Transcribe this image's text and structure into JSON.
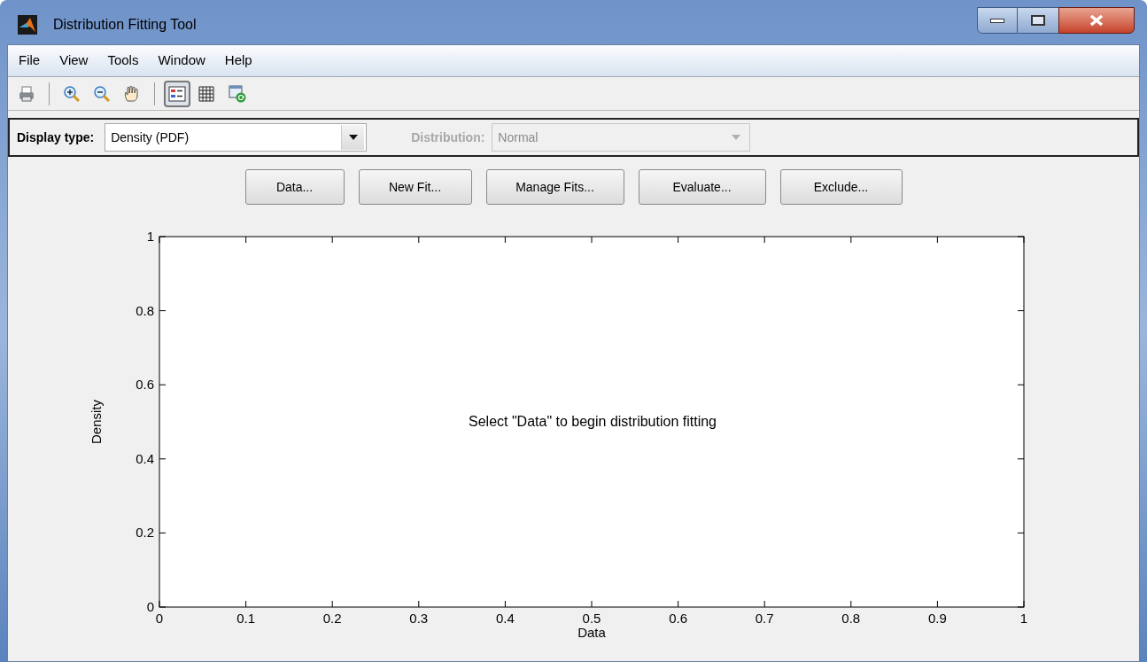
{
  "window": {
    "title": "Distribution Fitting Tool"
  },
  "menu": [
    "File",
    "View",
    "Tools",
    "Window",
    "Help"
  ],
  "toolbar": [
    {
      "pressed": false
    },
    {
      "pressed": false
    },
    {
      "pressed": false
    },
    {
      "pressed": false
    },
    {
      "pressed": true
    },
    {
      "pressed": false
    },
    {
      "pressed": false
    }
  ],
  "display_type": {
    "label": "Display type:",
    "value": "Density (PDF)",
    "disabled": false
  },
  "distribution": {
    "label": "Distribution:",
    "value": "Normal",
    "disabled": true
  },
  "buttons": [
    "Data...",
    "New Fit...",
    "Manage Fits...",
    "Evaluate...",
    "Exclude..."
  ],
  "plot": {
    "message": "Select \"Data\" to begin distribution fitting",
    "chart_data": {
      "type": "line",
      "xlabel": "Data",
      "ylabel": "Density",
      "xlim": [
        0,
        1
      ],
      "ylim": [
        0,
        1
      ],
      "xticks": [
        {
          "value": 0,
          "label": "0"
        },
        {
          "value": 0.1,
          "label": "0.1"
        },
        {
          "value": 0.2,
          "label": "0.2"
        },
        {
          "value": 0.3,
          "label": "0.3"
        },
        {
          "value": 0.4,
          "label": "0.4"
        },
        {
          "value": 0.5,
          "label": "0.5"
        },
        {
          "value": 0.6,
          "label": "0.6"
        },
        {
          "value": 0.7,
          "label": "0.7"
        },
        {
          "value": 0.8,
          "label": "0.8"
        },
        {
          "value": 0.9,
          "label": "0.9"
        },
        {
          "value": 1,
          "label": "1"
        }
      ],
      "yticks": [
        {
          "value": 0,
          "label": "0"
        },
        {
          "value": 0.2,
          "label": "0.2"
        },
        {
          "value": 0.4,
          "label": "0.4"
        },
        {
          "value": 0.6,
          "label": "0.6"
        },
        {
          "value": 0.8,
          "label": "0.8"
        },
        {
          "value": 1,
          "label": "1"
        }
      ]
    }
  }
}
